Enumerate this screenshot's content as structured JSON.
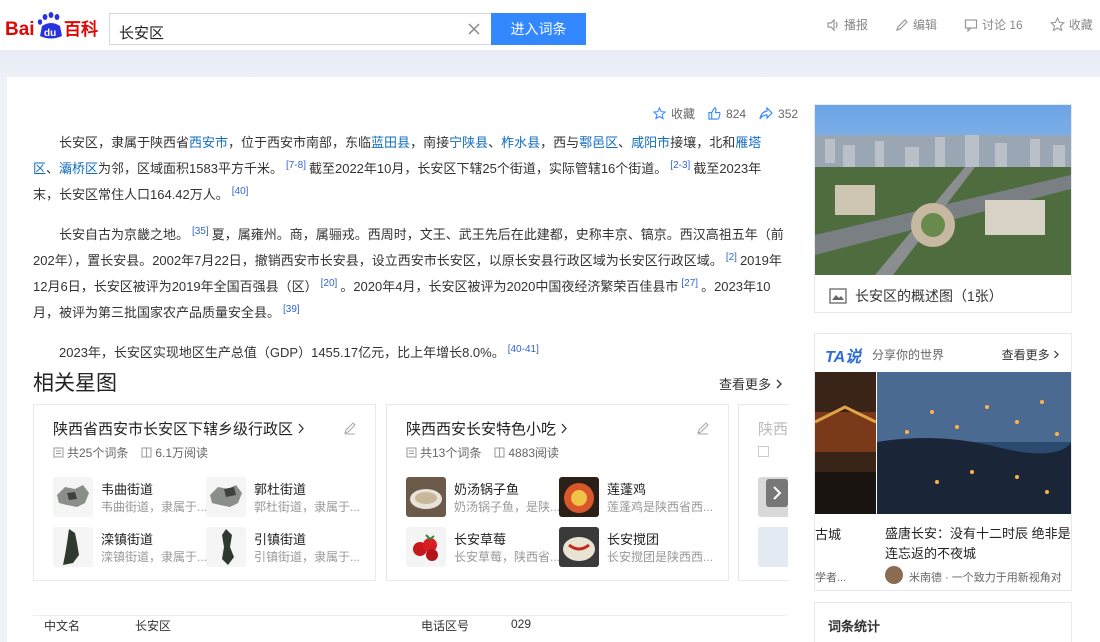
{
  "header": {
    "logo_text": "Bai百科",
    "search_value": "长安区",
    "search_button": "进入词条",
    "toolbar": [
      "播报",
      "编辑",
      "讨论 16",
      "收藏"
    ]
  },
  "stats": {
    "favorite": "收藏",
    "likes": "824",
    "shares": "352"
  },
  "summary": {
    "p1": {
      "s1": "长安区，隶属于陕西省",
      "l1": "西安市",
      "s2": "，位于西安市南部，东临",
      "l2": "蓝田县",
      "s3": "，南接",
      "l3": "宁陕县",
      "s4": "、",
      "l4": "柞水县",
      "s5": "，西与",
      "l5": "鄠邑区",
      "s6": "、",
      "l6": "咸阳市",
      "s7": "接壤，北和",
      "l7": "雁塔区",
      "s8": "、",
      "l8": "灞桥区",
      "s9": "为邻，区域面积1583平方千米。",
      "r1": "[7-8]",
      "s10": "截至2022年10月，长安区下辖25个街道，实际管辖16个街道。",
      "r2": "[2-3]",
      "s11": "截至2023年末，长安区常住人口164.42万人。",
      "r3": "[40]"
    },
    "p2": {
      "s1": "长安自古为京畿之地。",
      "r1": "[35]",
      "s2": "夏，属雍州。商，属骊戎。西周时，文王、武王先后在此建都，史称丰京、镐京。西汉高祖五年（前202年），置长安县。2002年7月22日，撤销西安市长安县，设立西安市长安区，以原长安县行政区域为长安区行政区域。",
      "r2": "[2]",
      "s3": "2019年12月6日，长安区被评为2019年全国百强县（区）",
      "r3": "[20]",
      "s4": "。2020年4月，长安区被评为2020中国夜经济繁荣百佳县市",
      "r4": "[27]",
      "s5": "。2023年10月，被评为第三批国家农产品质量安全县。",
      "r5": "[39]"
    },
    "p3": {
      "s1": "2023年，长安区实现地区生产总值（GDP）1455.17亿元，比上年增长8.0%。",
      "r1": "[40-41]"
    }
  },
  "related": {
    "title": "相关星图",
    "more": "查看更多",
    "cards": [
      {
        "title": "陕西省西安市长安区下辖乡级行政区",
        "count": "共25个词条",
        "reads": "6.1万阅读",
        "items": [
          {
            "name": "韦曲街道",
            "desc": "韦曲街道，隶属于..."
          },
          {
            "name": "郭杜街道",
            "desc": "郭杜街道，隶属于..."
          },
          {
            "name": "滦镇街道",
            "desc": "滦镇街道，隶属于..."
          },
          {
            "name": "引镇街道",
            "desc": "引镇街道，隶属于..."
          }
        ]
      },
      {
        "title": "陕西西安长安特色小吃",
        "count": "共13个词条",
        "reads": "4883阅读",
        "items": [
          {
            "name": "奶汤锅子鱼",
            "desc": "奶汤锅子鱼，是陕..."
          },
          {
            "name": "莲蓬鸡",
            "desc": "莲蓬鸡是陕西省西..."
          },
          {
            "name": "长安草莓",
            "desc": "长安草莓，陕西省..."
          },
          {
            "name": "长安搅团",
            "desc": "长安搅团是陕西西..."
          }
        ]
      },
      {
        "title": "陕西"
      }
    ]
  },
  "basic_info": {
    "label1": "中文名",
    "value1": "长安区",
    "label2": "电话区号",
    "value2": "029"
  },
  "album": {
    "caption": "长安区的概述图（1张）"
  },
  "ta": {
    "brand": "TA说",
    "slogan": "分享你的世界",
    "more": "查看更多",
    "title1": "古城",
    "title2": "盛唐长安：没有十二时辰 绝非是连忘返的不夜城",
    "author1": "学者...",
    "author2": "米南德 · 一个致力于用新视角对"
  },
  "stat_box": {
    "title": "词条统计"
  },
  "colors": {
    "accent": "#3388ff",
    "link": "#136ec2",
    "brand_red": "#e10601",
    "brand_blue": "#2932e1"
  }
}
